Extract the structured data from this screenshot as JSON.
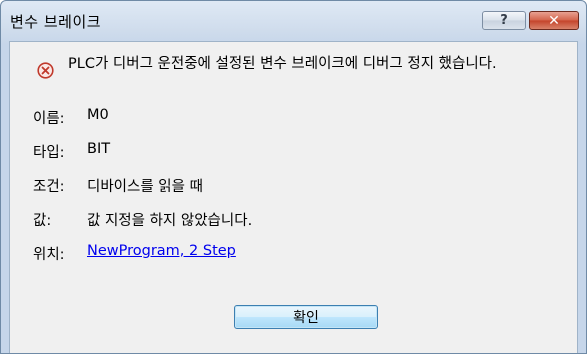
{
  "window": {
    "title": "변수 브레이크",
    "help_glyph": "?",
    "close_glyph": "✕"
  },
  "dialog": {
    "icon": "error-circle-icon",
    "message": "PLC가 디버그 운전중에 설정된 변수 브레이크에 디버그 정지 했습니다.",
    "fields": {
      "name": {
        "label": "이름:",
        "value": "M0"
      },
      "type": {
        "label": "타입:",
        "value": "BIT"
      },
      "condition": {
        "label": "조건:",
        "value": "디바이스를 읽을 때"
      },
      "value": {
        "label": "값:",
        "value": "값 지정을 하지 않았습니다."
      },
      "location": {
        "label": "위치:",
        "value": "NewProgram, 2 Step"
      }
    },
    "ok_label": "확인"
  },
  "colors": {
    "link": "#0000ee",
    "error_icon": "#c0392b",
    "close_button": "#c4432a"
  }
}
